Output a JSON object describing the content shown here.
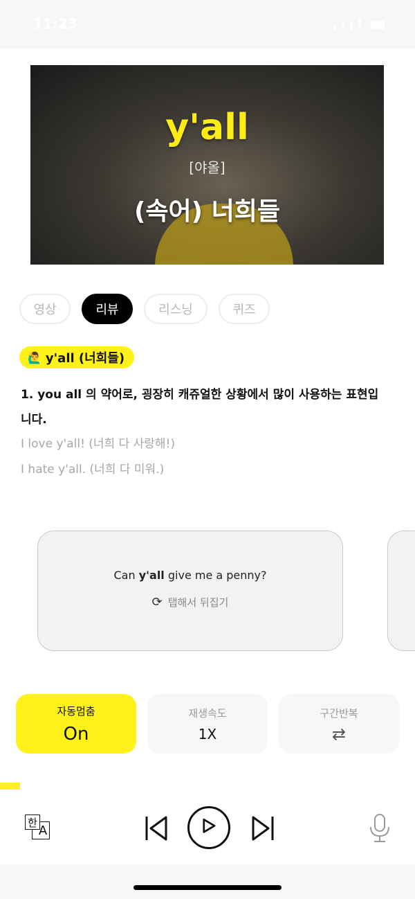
{
  "status_bar": {
    "time": "11:23"
  },
  "video": {
    "word": "y'all",
    "pronunciation": "[야올]",
    "meaning": "(속어) 너희들"
  },
  "tabs": [
    {
      "label": "영상",
      "active": false
    },
    {
      "label": "리뷰",
      "active": true
    },
    {
      "label": "리스닝",
      "active": false
    },
    {
      "label": "퀴즈",
      "active": false
    }
  ],
  "review": {
    "chip_emoji": "🙋‍♂️",
    "chip_label": "y'all (너희들)",
    "definition": "1. you all 의 약어로, 굉장히 캐쥬얼한 상황에서 많이 사용하는 표현입니다.",
    "examples": [
      "I love y'all! (너희 다 사랑해!)",
      "I hate y'all. (너희 다 미워.)"
    ]
  },
  "flashcard": {
    "sentence_before": "Can ",
    "sentence_bold": "y'all",
    "sentence_after": " give me a penny?",
    "flip_label": "탭해서 뒤집기",
    "flip_icon": "refresh-icon"
  },
  "controls": {
    "auto_stop": {
      "label": "자동멈춤",
      "value": "On"
    },
    "speed": {
      "label": "재생속도",
      "value": "1X"
    },
    "repeat": {
      "label": "구간반복",
      "icon": "repeat-icon"
    }
  },
  "player": {
    "translate_icon": {
      "han": "한",
      "a": "A"
    }
  },
  "colors": {
    "accent_yellow": "#fff21a",
    "text_muted": "#a6a6a6",
    "card_bg": "#f2f2f2"
  }
}
